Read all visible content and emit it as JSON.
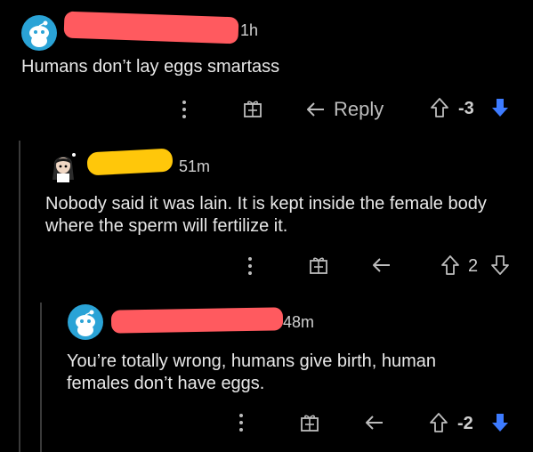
{
  "colors": {
    "background": "#000000",
    "text": "#e8e8e8",
    "muted": "#bdbdbd",
    "downvote": "#3d7bff",
    "redaction_red": "#ff5a5f",
    "redaction_yellow": "#ffc70a",
    "avatar_blue": "#2aa3d6"
  },
  "comments": [
    {
      "avatar_icon": "snoo-avatar-icon",
      "time": "1h",
      "body": "Humans don’t lay eggs smartass",
      "actions": {
        "more_icon": "more-vertical-icon",
        "award_icon": "gift-icon",
        "reply_icon": "reply-arrow-icon",
        "reply_label": "Reply",
        "upvote_icon": "arrow-up-icon",
        "score": "-3",
        "downvote_icon": "arrow-down-icon"
      }
    },
    {
      "avatar_icon": "custom-avatar-icon",
      "time": "51m",
      "body": "Nobody said it was lain. It is kept inside the female body\nwhere the sperm will fertilize it.",
      "actions": {
        "more_icon": "more-vertical-icon",
        "award_icon": "gift-icon",
        "reply_icon": "reply-arrow-icon",
        "upvote_icon": "arrow-up-icon",
        "score": "2",
        "downvote_icon": "arrow-down-icon"
      }
    },
    {
      "avatar_icon": "snoo-avatar-icon",
      "time": "48m",
      "body": "You’re totally wrong, humans give birth, human\nfemales don’t have eggs.",
      "actions": {
        "more_icon": "more-vertical-icon",
        "award_icon": "gift-icon",
        "reply_icon": "reply-arrow-icon",
        "upvote_icon": "arrow-up-icon",
        "score": "-2",
        "downvote_icon": "arrow-down-icon"
      }
    }
  ]
}
